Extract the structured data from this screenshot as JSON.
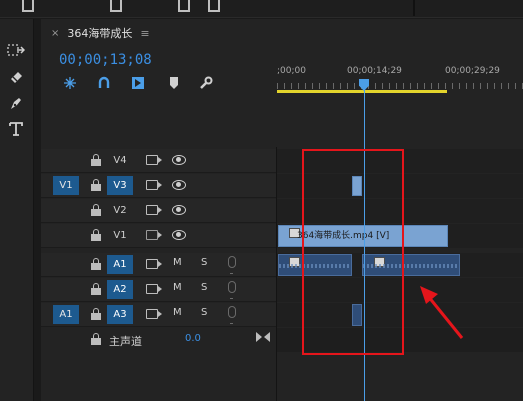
{
  "panel": {
    "tab_title": "364海带成长",
    "close_glyph": "×",
    "menu_glyph": "≡"
  },
  "timecode": "00;00;13;08",
  "ruler": {
    "labels": [
      ";00;00",
      "00;00;14;29",
      "00;00;29;29"
    ]
  },
  "tracks": {
    "video": [
      {
        "name": "V4",
        "source": "",
        "targeted": false,
        "visibility": "eye"
      },
      {
        "name": "V3",
        "source": "V1",
        "targeted": true,
        "visibility": "eye"
      },
      {
        "name": "V2",
        "source": "",
        "targeted": false,
        "visibility": "eye"
      },
      {
        "name": "V1",
        "source": "",
        "targeted": false,
        "visibility": "eye-hidden"
      }
    ],
    "audio": [
      {
        "name": "A1",
        "source": "",
        "targeted": true,
        "mute": "M",
        "solo": "S"
      },
      {
        "name": "A2",
        "source": "",
        "targeted": true,
        "mute": "M",
        "solo": "S"
      },
      {
        "name": "A3",
        "source": "A1",
        "targeted": true,
        "mute": "M",
        "solo": "S"
      }
    ],
    "master": {
      "label": "主声道",
      "value": "0.0"
    }
  },
  "clips": {
    "v1_name": "364海带成长.mp4 [V]"
  },
  "colors": {
    "accent_blue": "#3b8fe3",
    "playhead": "#4b9ee8",
    "work_area": "#e3d42c",
    "video_clip": "#7aa3d2",
    "audio_clip": "#2f4d78",
    "annotation_red": "#e5151b"
  },
  "icons": {
    "tools": [
      "track-select-icon",
      "razor-icon",
      "pen-icon",
      "type-tool-icon"
    ],
    "header": [
      "snap-icon",
      "magnet-link-icon",
      "add-marker-icon",
      "marker-icon",
      "wrench-icon"
    ]
  }
}
